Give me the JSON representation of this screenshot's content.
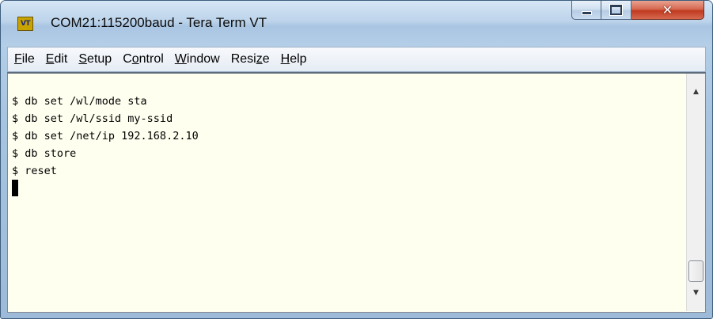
{
  "window": {
    "title": "COM21:115200baud - Tera Term VT",
    "icon_label": "VT"
  },
  "menu": [
    {
      "label": "File",
      "mnemonic_prefix": "",
      "mnemonic": "F",
      "rest": "ile"
    },
    {
      "label": "Edit",
      "mnemonic_prefix": "",
      "mnemonic": "E",
      "rest": "dit"
    },
    {
      "label": "Setup",
      "mnemonic_prefix": "",
      "mnemonic": "S",
      "rest": "etup"
    },
    {
      "label": "Control",
      "mnemonic_prefix": "C",
      "mnemonic": "o",
      "rest": "ntrol"
    },
    {
      "label": "Window",
      "mnemonic_prefix": "",
      "mnemonic": "W",
      "rest": "indow"
    },
    {
      "label": "Resize",
      "mnemonic_prefix": "Resi",
      "mnemonic": "z",
      "rest": "e"
    },
    {
      "label": "Help",
      "mnemonic_prefix": "",
      "mnemonic": "H",
      "rest": "elp"
    }
  ],
  "terminal": {
    "lines": [
      "$ db set /wl/mode sta",
      "$ db set /wl/ssid my-ssid",
      "$ db set /net/ip 192.168.2.10",
      "$ db store",
      "$ reset"
    ]
  },
  "icons": {
    "minimize": "minimize-icon",
    "maximize": "maximize-icon",
    "close": "close-icon",
    "scroll_up": "scroll-up-arrow-icon",
    "scroll_down": "scroll-down-arrow-icon"
  },
  "colors": {
    "terminal_bg": "#fffff0",
    "terminal_fg": "#000000",
    "close_button": "#c03a20"
  }
}
